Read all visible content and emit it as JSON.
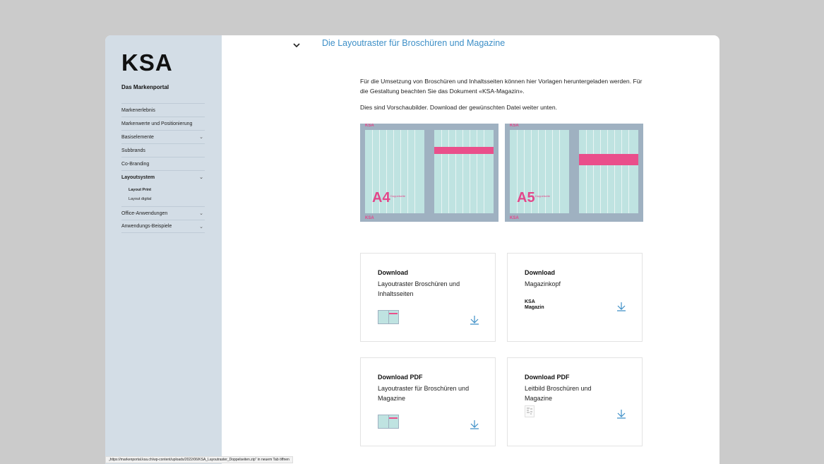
{
  "sidebar": {
    "logo": "KSA",
    "portal_title": "Das Markenportal",
    "items": [
      {
        "label": "Markenerlebnis"
      },
      {
        "label": "Markenwerte und Positionierung"
      },
      {
        "label": "Basiselemente",
        "chevron": "›"
      },
      {
        "label": "Subbrands"
      },
      {
        "label": "Co-Branding"
      },
      {
        "label": "Layoutsystem",
        "chevron": "›"
      },
      {
        "label": "Office-Anwendungen",
        "chevron": "›"
      },
      {
        "label": "Anwendungs-Beispiele",
        "chevron": "›"
      }
    ],
    "subitems": [
      {
        "label": "Layout Print"
      },
      {
        "label": "Layout digital"
      }
    ]
  },
  "main": {
    "section_title": "Die Layoutraster für Broschüren und Magazine",
    "intro": "Für die Umsetzung von Broschüren und Inhaltsseiten können hier Vorlagen heruntergeladen werden. Für die Gestaltung beachten Sie das Dokument «KSA-Magazin».",
    "intro2": "Dies sind Vorschaubilder. Download der gewünschten Datei weiter unten.",
    "previews": [
      {
        "format": "A4",
        "label": "Doppelseite",
        "brand": "KSA"
      },
      {
        "format": "A5",
        "label": "Doppelseite",
        "brand": "KSA"
      }
    ],
    "cards": [
      {
        "title": "Download",
        "desc": "Layoutraster Broschüren und Inhaltsseiten"
      },
      {
        "title": "Download",
        "desc": "Magazinkopf",
        "logo_line1": "KSA",
        "logo_line2": "Magazin"
      },
      {
        "title": "Download PDF",
        "desc": "Layoutraster für Broschüren und Magazine"
      },
      {
        "title": "Download PDF",
        "desc": "Leitbild Broschüren und Magazine"
      }
    ]
  },
  "statusbar": {
    "text": "„https://markenportal.ksa.ch/wp-content/uploads/2022/06/KSA_Layoutraster_Doppelseiten.zip“ in neuem Tab öffnen"
  },
  "colors": {
    "accent": "#3d8fc7",
    "pink": "#ea4f8b",
    "grid": "#bfe3e1",
    "sidebar": "#d3dde6"
  },
  "icons": {
    "toggle": "chevron-down-icon",
    "download": "download-arrow-icon"
  }
}
